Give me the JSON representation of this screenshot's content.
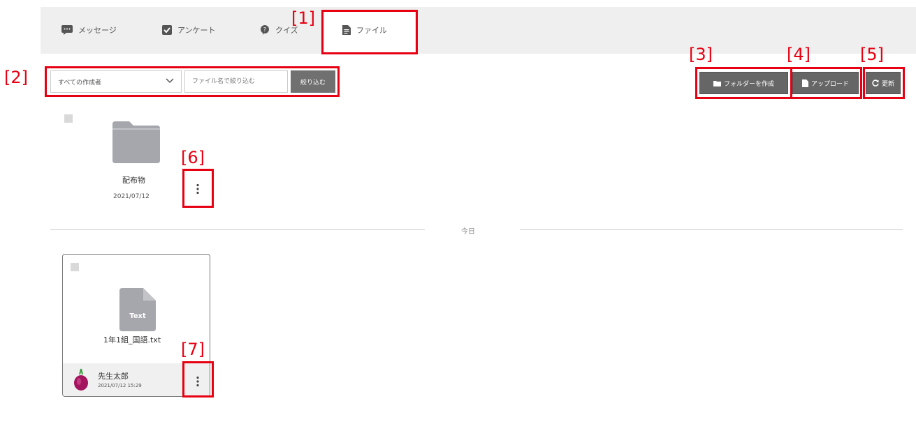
{
  "tabs": [
    {
      "label": "メッセージ",
      "icon": "message-icon"
    },
    {
      "label": "アンケート",
      "icon": "checkbox-icon"
    },
    {
      "label": "クイズ",
      "icon": "quiz-icon"
    },
    {
      "label": "ファイル",
      "icon": "file-icon",
      "active": true
    }
  ],
  "toolbar": {
    "creator_select": "すべての作成者",
    "filter_placeholder": "ファイル名で絞り込む",
    "filter_button": "絞り込む",
    "create_folder_button": "フォルダーを作成",
    "upload_button": "アップロード",
    "refresh_button": "更新"
  },
  "folder": {
    "name": "配布物",
    "date": "2021/07/12"
  },
  "date_separator": "今日",
  "file": {
    "type_label": "Text",
    "name": "1年1組_国語.txt",
    "author": "先生太郎",
    "timestamp": "2021/07/12 15:29"
  },
  "callouts": [
    "[1]",
    "[2]",
    "[3]",
    "[4]",
    "[5]",
    "[6]",
    "[7]"
  ],
  "colors": {
    "callout": "#e60012",
    "button": "#666666",
    "folder": "#a6a7ad",
    "file_icon": "#a6a7ad"
  }
}
